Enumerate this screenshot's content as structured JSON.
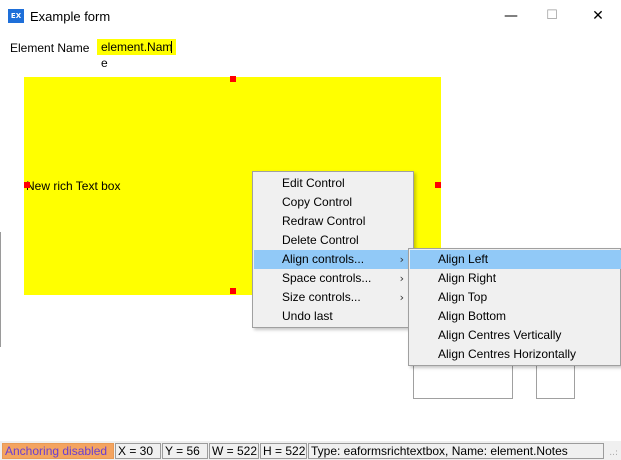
{
  "window": {
    "icon_text": "EX",
    "title": "Example form",
    "min_glyph": "—",
    "max_glyph": "☐",
    "close_glyph": "✕"
  },
  "form": {
    "element_name_label": "Element Name",
    "element_name_before_caret": "element.Nam",
    "element_name_after_caret": "e",
    "rich_text_label": "New rich Text box"
  },
  "context_menu": {
    "items": [
      {
        "label": "Edit Control"
      },
      {
        "label": "Copy Control"
      },
      {
        "label": "Redraw Control"
      },
      {
        "label": "Delete Control"
      },
      {
        "label": "Align controls...",
        "arrow": "›"
      },
      {
        "label": "Space controls...",
        "arrow": "›"
      },
      {
        "label": "Size controls...",
        "arrow": "›"
      },
      {
        "label": "Undo last"
      }
    ]
  },
  "align_submenu": {
    "items": [
      {
        "label": "Align Left"
      },
      {
        "label": "Align Right"
      },
      {
        "label": "Align Top"
      },
      {
        "label": "Align Bottom"
      },
      {
        "label": "Align Centres Vertically"
      },
      {
        "label": "Align Centres Horizontally"
      }
    ]
  },
  "status": {
    "anchoring": "Anchoring disabled",
    "x": "X = 30",
    "y": "Y = 56",
    "w": "W = 522",
    "h": "H = 522",
    "info": "Type: eaformsrichtextbox, Name: element.Notes",
    "grip": "..:"
  },
  "colors": {
    "selection_fill": "#ffff00",
    "handle": "#ff0000",
    "menu_highlight": "#91c9f7",
    "anchoring_bg": "#f4a460",
    "anchoring_text": "#6a3fcf",
    "app_icon_bg": "#1e6fd9"
  }
}
